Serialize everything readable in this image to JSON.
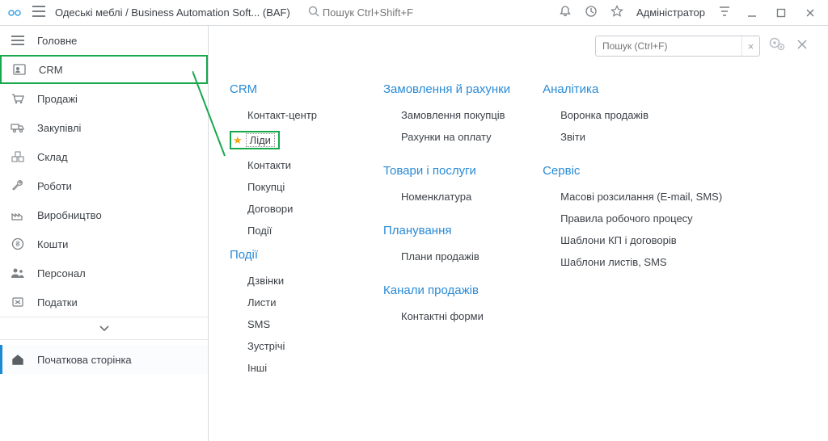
{
  "titlebar": {
    "app_title": "Одеські меблі / Business Automation Soft...   (BAF)",
    "search_placeholder": "Пошук Ctrl+Shift+F",
    "user_label": "Адміністратор",
    "icons": {
      "bell": "bell-icon",
      "history": "history-icon",
      "star": "star-icon",
      "filter": "filter-icon",
      "minimize": "minimize-icon",
      "maximize": "maximize-icon",
      "close": "close-icon"
    }
  },
  "sidebar": {
    "items": [
      {
        "label": "Головне"
      },
      {
        "label": "CRM"
      },
      {
        "label": "Продажі"
      },
      {
        "label": "Закупівлі"
      },
      {
        "label": "Склад"
      },
      {
        "label": "Роботи"
      },
      {
        "label": "Виробництво"
      },
      {
        "label": "Кошти"
      },
      {
        "label": "Персонал"
      },
      {
        "label": "Податки"
      }
    ],
    "home": {
      "label": "Початкова сторінка"
    }
  },
  "panel": {
    "search_placeholder": "Пошук (Ctrl+F)",
    "clear": "×"
  },
  "menu": {
    "col1": {
      "g1": {
        "title": "CRM",
        "items": [
          "Контакт-центр",
          "Ліди",
          "Контакти",
          "Покупці",
          "Договори",
          "Події"
        ]
      },
      "g2": {
        "title": "Події",
        "items": [
          "Дзвінки",
          "Листи",
          "SMS",
          "Зустрічі",
          "Інші"
        ]
      }
    },
    "col2": {
      "g1": {
        "title": "Замовлення й рахунки",
        "items": [
          "Замовлення покупців",
          "Рахунки на оплату"
        ]
      },
      "g2": {
        "title": "Товари і послуги",
        "items": [
          "Номенклатура"
        ]
      },
      "g3": {
        "title": "Планування",
        "items": [
          "Плани продажів"
        ]
      },
      "g4": {
        "title": "Канали продажів",
        "items": [
          "Контактні форми"
        ]
      }
    },
    "col3": {
      "g1": {
        "title": "Аналітика",
        "items": [
          "Воронка продажів",
          "Звіти"
        ]
      },
      "g2": {
        "title": "Сервіс",
        "items": [
          "Масові розсилання (E-mail, SMS)",
          "Правила робочого процесу",
          "Шаблони КП і договорів",
          "Шаблони листів, SMS"
        ]
      }
    }
  }
}
